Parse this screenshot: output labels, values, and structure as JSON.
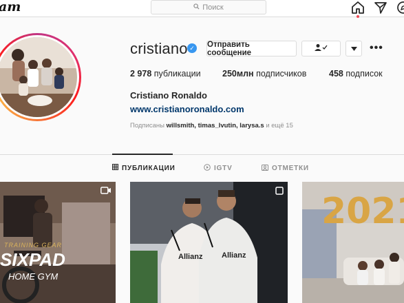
{
  "nav": {
    "logo_text": "am",
    "search_placeholder": "Поиск",
    "icons": [
      "home-icon",
      "direct-icon",
      "explore-icon"
    ],
    "notification_dot_color": "#ed4956"
  },
  "profile": {
    "username": "cristiano",
    "verified_mark": "✓",
    "message_button": "Отправить сообщение",
    "follow_state_icon": "person-check-icon",
    "suggest_icon": "chevron-down-icon",
    "more_icon": "•••",
    "stats": {
      "posts_count": "2 978",
      "posts_label": "публикации",
      "followers_count": "250млн",
      "followers_label": "подписчиков",
      "following_count": "458",
      "following_label": "подписок"
    },
    "full_name": "Cristiano Ronaldo",
    "website": "www.cristianoronaldo.com",
    "followed_by": {
      "prefix": "Подписаны",
      "names": "willsmith, timas_lvutin, larysa.s",
      "suffix": "и ещё 15"
    }
  },
  "tabs": [
    {
      "label": "ПУБЛИКАЦИИ",
      "icon": "grid-icon",
      "active": true
    },
    {
      "label": "IGTV",
      "icon": "igtv-icon",
      "active": false
    },
    {
      "label": "ОТМЕТКИ",
      "icon": "tagged-icon",
      "active": false
    }
  ],
  "posts": [
    {
      "badge": "video-icon",
      "overlay_text_1": "TRAINING GEAR",
      "overlay_text_2": "SIXPAD",
      "overlay_text_3": "HOME GYM"
    },
    {
      "badge": "carousel-icon",
      "jersey_text_left": "Allianz",
      "jersey_text_right": "Allianz"
    },
    {
      "badge": "none",
      "balloons": "2021"
    }
  ],
  "colors": {
    "accent_blue": "#3897f0",
    "link_blue": "#00376b",
    "text": "#262626",
    "muted": "#8e8e8e",
    "border": "#dbdbdb"
  }
}
